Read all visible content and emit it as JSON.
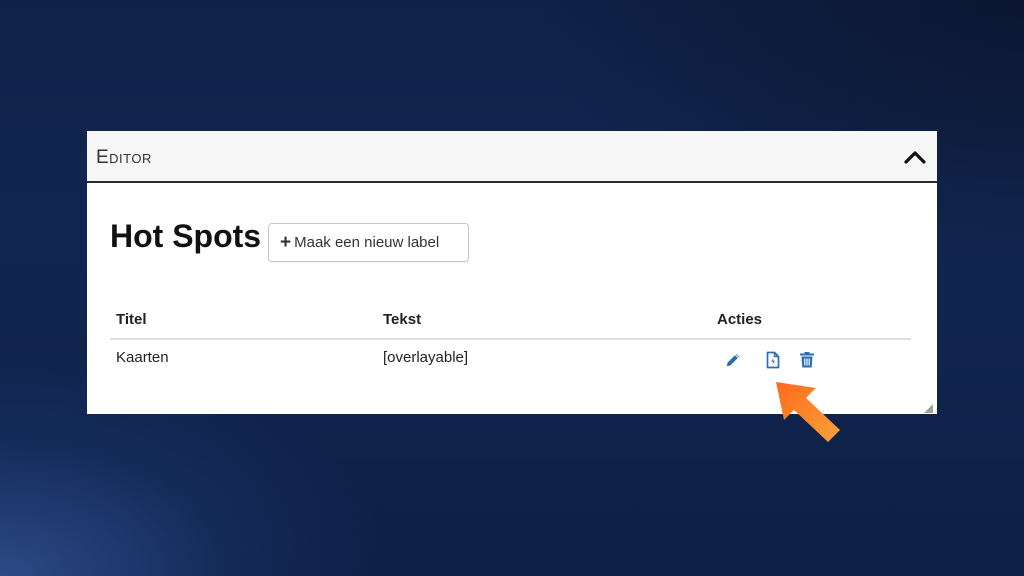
{
  "editor": {
    "title": "Editor",
    "collapse_icon": "chevron-up-icon"
  },
  "section": {
    "title": "Hot Spots",
    "new_label_button": "Maak een nieuw label",
    "new_label_icon": "plus-icon"
  },
  "table": {
    "columns": [
      "Titel",
      "Tekst",
      "Acties"
    ],
    "rows": [
      {
        "titel": "Kaarten",
        "tekst": "[overlayable]",
        "actions": [
          "pencil-icon",
          "document-icon",
          "trash-icon"
        ]
      }
    ]
  },
  "colors": {
    "background": "#112752",
    "action_icon": "#2a6db5",
    "pointer_arrow": "#f47a1f"
  }
}
